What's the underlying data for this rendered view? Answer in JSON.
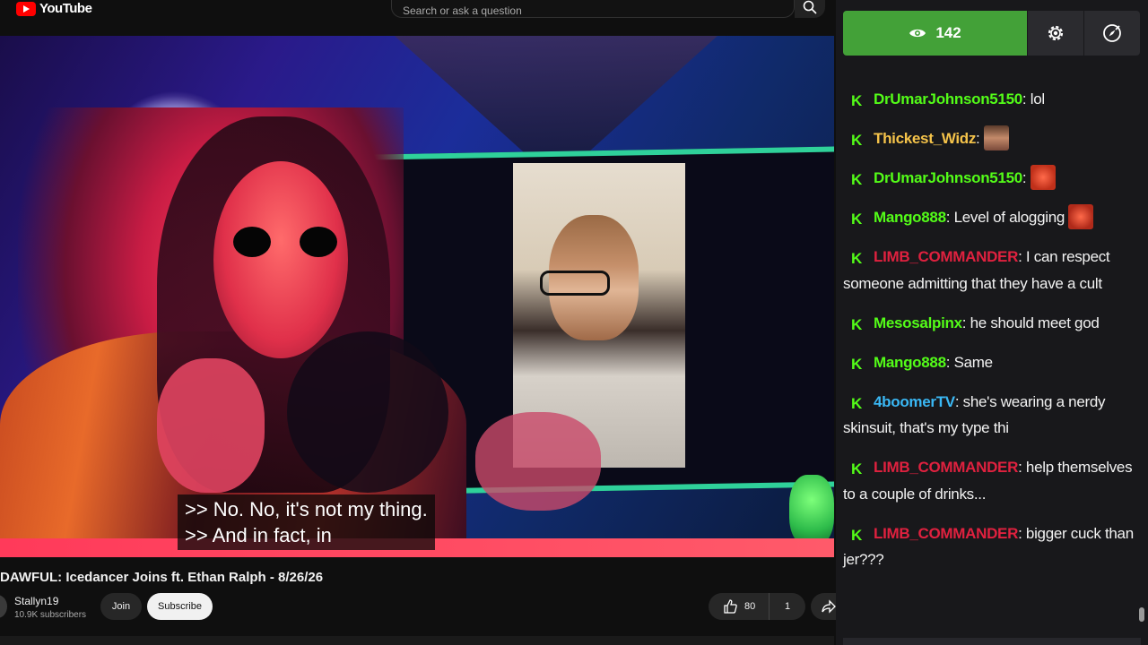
{
  "youtube": {
    "logo_text": "YouTube",
    "search_placeholder": "Search or ask a question"
  },
  "video": {
    "caption_lines": [
      ">> No. No, it's not my thing.",
      ">> And in fact, in"
    ],
    "title": "DAWFUL: Icedancer Joins ft. Ethan Ralph - 8/26/26",
    "channel": "Stallyn19",
    "subscribers": "10.9K subscribers",
    "join_label": "Join",
    "subscribe_label": "Subscribe",
    "likes": "80",
    "dislikes": "1"
  },
  "chat": {
    "viewer_count": "142",
    "messages": [
      {
        "user": "DrUmarJohnson5150",
        "color": "#53fc18",
        "text": ": lol"
      },
      {
        "user": "Thickest_Widz",
        "color": "#f5c34a",
        "text": ": ",
        "emote": "face-emote"
      },
      {
        "user": "DrUmarJohnson5150",
        "color": "#53fc18",
        "text": ": ",
        "emote": "face-emote"
      },
      {
        "user": "Mango888",
        "color": "#53fc18",
        "text": ": Level of alogging ",
        "emote": "face-emote"
      },
      {
        "user": "LIMB_COMMANDER",
        "color": "#e0213f",
        "text": ": I can respect someone admitting that they have a cult"
      },
      {
        "user": "Mesosalpinx",
        "color": "#53fc18",
        "text": ": he should meet god"
      },
      {
        "user": "Mango888",
        "color": "#53fc18",
        "text": ": Same"
      },
      {
        "user": "4boomerTV",
        "color": "#3ab8f5",
        "text": ": she's wearing a nerdy skinsuit, that's my type thi"
      },
      {
        "user": "LIMB_COMMANDER",
        "color": "#e0213f",
        "text": ": help themselves to a couple of drinks..."
      },
      {
        "user": "LIMB_COMMANDER",
        "color": "#e0213f",
        "text": ": bigger cuck than jer???"
      }
    ],
    "badge": "K",
    "badge_color": "#53fc18"
  },
  "colors": {
    "viewer_bg": "#43a138",
    "chat_bg": "#18181b",
    "yt_bg": "#0f0f0f"
  }
}
